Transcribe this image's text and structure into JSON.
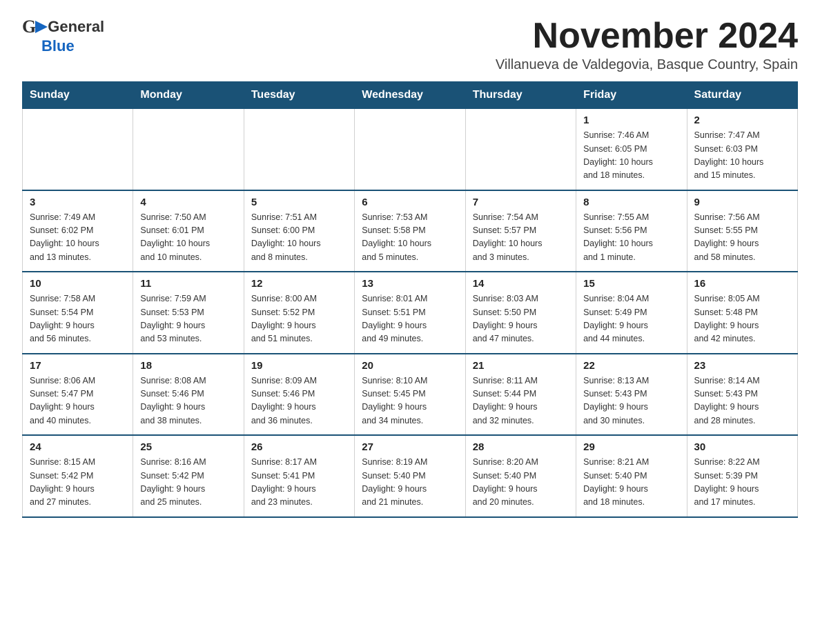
{
  "header": {
    "logo_general": "General",
    "logo_blue": "Blue",
    "month_title": "November 2024",
    "subtitle": "Villanueva de Valdegovia, Basque Country, Spain"
  },
  "weekdays": [
    "Sunday",
    "Monday",
    "Tuesday",
    "Wednesday",
    "Thursday",
    "Friday",
    "Saturday"
  ],
  "weeks": [
    [
      {
        "day": "",
        "info": ""
      },
      {
        "day": "",
        "info": ""
      },
      {
        "day": "",
        "info": ""
      },
      {
        "day": "",
        "info": ""
      },
      {
        "day": "",
        "info": ""
      },
      {
        "day": "1",
        "info": "Sunrise: 7:46 AM\nSunset: 6:05 PM\nDaylight: 10 hours\nand 18 minutes."
      },
      {
        "day": "2",
        "info": "Sunrise: 7:47 AM\nSunset: 6:03 PM\nDaylight: 10 hours\nand 15 minutes."
      }
    ],
    [
      {
        "day": "3",
        "info": "Sunrise: 7:49 AM\nSunset: 6:02 PM\nDaylight: 10 hours\nand 13 minutes."
      },
      {
        "day": "4",
        "info": "Sunrise: 7:50 AM\nSunset: 6:01 PM\nDaylight: 10 hours\nand 10 minutes."
      },
      {
        "day": "5",
        "info": "Sunrise: 7:51 AM\nSunset: 6:00 PM\nDaylight: 10 hours\nand 8 minutes."
      },
      {
        "day": "6",
        "info": "Sunrise: 7:53 AM\nSunset: 5:58 PM\nDaylight: 10 hours\nand 5 minutes."
      },
      {
        "day": "7",
        "info": "Sunrise: 7:54 AM\nSunset: 5:57 PM\nDaylight: 10 hours\nand 3 minutes."
      },
      {
        "day": "8",
        "info": "Sunrise: 7:55 AM\nSunset: 5:56 PM\nDaylight: 10 hours\nand 1 minute."
      },
      {
        "day": "9",
        "info": "Sunrise: 7:56 AM\nSunset: 5:55 PM\nDaylight: 9 hours\nand 58 minutes."
      }
    ],
    [
      {
        "day": "10",
        "info": "Sunrise: 7:58 AM\nSunset: 5:54 PM\nDaylight: 9 hours\nand 56 minutes."
      },
      {
        "day": "11",
        "info": "Sunrise: 7:59 AM\nSunset: 5:53 PM\nDaylight: 9 hours\nand 53 minutes."
      },
      {
        "day": "12",
        "info": "Sunrise: 8:00 AM\nSunset: 5:52 PM\nDaylight: 9 hours\nand 51 minutes."
      },
      {
        "day": "13",
        "info": "Sunrise: 8:01 AM\nSunset: 5:51 PM\nDaylight: 9 hours\nand 49 minutes."
      },
      {
        "day": "14",
        "info": "Sunrise: 8:03 AM\nSunset: 5:50 PM\nDaylight: 9 hours\nand 47 minutes."
      },
      {
        "day": "15",
        "info": "Sunrise: 8:04 AM\nSunset: 5:49 PM\nDaylight: 9 hours\nand 44 minutes."
      },
      {
        "day": "16",
        "info": "Sunrise: 8:05 AM\nSunset: 5:48 PM\nDaylight: 9 hours\nand 42 minutes."
      }
    ],
    [
      {
        "day": "17",
        "info": "Sunrise: 8:06 AM\nSunset: 5:47 PM\nDaylight: 9 hours\nand 40 minutes."
      },
      {
        "day": "18",
        "info": "Sunrise: 8:08 AM\nSunset: 5:46 PM\nDaylight: 9 hours\nand 38 minutes."
      },
      {
        "day": "19",
        "info": "Sunrise: 8:09 AM\nSunset: 5:46 PM\nDaylight: 9 hours\nand 36 minutes."
      },
      {
        "day": "20",
        "info": "Sunrise: 8:10 AM\nSunset: 5:45 PM\nDaylight: 9 hours\nand 34 minutes."
      },
      {
        "day": "21",
        "info": "Sunrise: 8:11 AM\nSunset: 5:44 PM\nDaylight: 9 hours\nand 32 minutes."
      },
      {
        "day": "22",
        "info": "Sunrise: 8:13 AM\nSunset: 5:43 PM\nDaylight: 9 hours\nand 30 minutes."
      },
      {
        "day": "23",
        "info": "Sunrise: 8:14 AM\nSunset: 5:43 PM\nDaylight: 9 hours\nand 28 minutes."
      }
    ],
    [
      {
        "day": "24",
        "info": "Sunrise: 8:15 AM\nSunset: 5:42 PM\nDaylight: 9 hours\nand 27 minutes."
      },
      {
        "day": "25",
        "info": "Sunrise: 8:16 AM\nSunset: 5:42 PM\nDaylight: 9 hours\nand 25 minutes."
      },
      {
        "day": "26",
        "info": "Sunrise: 8:17 AM\nSunset: 5:41 PM\nDaylight: 9 hours\nand 23 minutes."
      },
      {
        "day": "27",
        "info": "Sunrise: 8:19 AM\nSunset: 5:40 PM\nDaylight: 9 hours\nand 21 minutes."
      },
      {
        "day": "28",
        "info": "Sunrise: 8:20 AM\nSunset: 5:40 PM\nDaylight: 9 hours\nand 20 minutes."
      },
      {
        "day": "29",
        "info": "Sunrise: 8:21 AM\nSunset: 5:40 PM\nDaylight: 9 hours\nand 18 minutes."
      },
      {
        "day": "30",
        "info": "Sunrise: 8:22 AM\nSunset: 5:39 PM\nDaylight: 9 hours\nand 17 minutes."
      }
    ]
  ]
}
